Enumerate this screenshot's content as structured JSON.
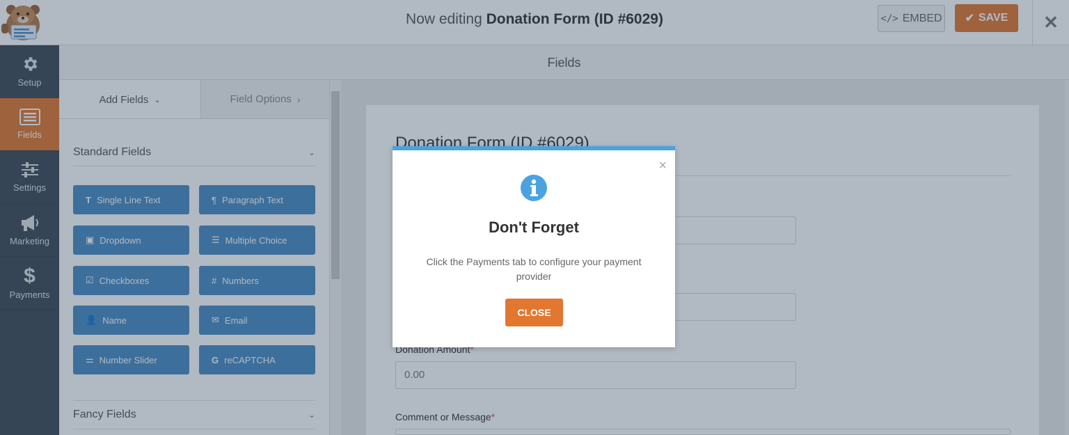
{
  "header": {
    "title_prefix": "Now editing ",
    "title_form": "Donation Form (ID #6029)",
    "embed_label": "EMBED",
    "save_label": "SAVE"
  },
  "nav": {
    "items": [
      {
        "label": "Setup",
        "icon": "gear-icon"
      },
      {
        "label": "Fields",
        "icon": "list-icon",
        "active": true
      },
      {
        "label": "Settings",
        "icon": "sliders-icon"
      },
      {
        "label": "Marketing",
        "icon": "megaphone-icon"
      },
      {
        "label": "Payments",
        "icon": "dollar-icon"
      }
    ]
  },
  "fields_bar": {
    "title": "Fields"
  },
  "panel": {
    "tab_add": "Add Fields",
    "tab_options": "Field Options",
    "standard_section": "Standard Fields",
    "fancy_section": "Fancy Fields",
    "buttons": [
      {
        "label": "Single Line Text",
        "icon": "text-icon"
      },
      {
        "label": "Paragraph Text",
        "icon": "paragraph-icon"
      },
      {
        "label": "Dropdown",
        "icon": "dropdown-icon"
      },
      {
        "label": "Multiple Choice",
        "icon": "list-icon"
      },
      {
        "label": "Checkboxes",
        "icon": "checkbox-icon"
      },
      {
        "label": "Numbers",
        "icon": "hash-icon"
      },
      {
        "label": "Name",
        "icon": "user-icon"
      },
      {
        "label": "Email",
        "icon": "envelope-icon"
      },
      {
        "label": "Number Slider",
        "icon": "sliders-icon"
      },
      {
        "label": "reCAPTCHA",
        "icon": "google-icon"
      }
    ]
  },
  "preview": {
    "form_title": "Donation Form (ID #6029)",
    "donation_label": "Donation Amount",
    "donation_value": "0.00",
    "comment_label": "Comment or Message",
    "required_mark": "*"
  },
  "modal": {
    "title": "Don't Forget",
    "text": "Click the Payments tab to configure your payment provider",
    "button": "CLOSE",
    "close_glyph": "×",
    "accent": "#4aa3df"
  },
  "colors": {
    "accent": "#e27730",
    "field_button": "#4a8cc4",
    "nav_bg": "#3d4a57"
  }
}
